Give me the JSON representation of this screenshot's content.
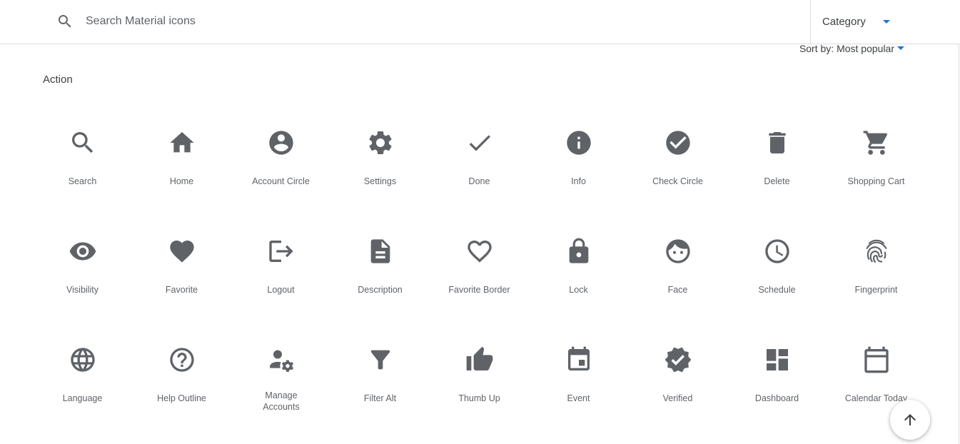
{
  "search": {
    "placeholder": "Search Material icons"
  },
  "category": {
    "label": "Category"
  },
  "sort": {
    "label": "Sort by: Most popular"
  },
  "section": {
    "title": "Action"
  },
  "colors": {
    "icon": "#5f6368",
    "accent": "#1a73e8",
    "divider": "#dadce0"
  },
  "icons": [
    {
      "name": "Search",
      "icon": "search-icon"
    },
    {
      "name": "Home",
      "icon": "home-icon"
    },
    {
      "name": "Account Circle",
      "icon": "account-circle-icon"
    },
    {
      "name": "Settings",
      "icon": "settings-icon"
    },
    {
      "name": "Done",
      "icon": "done-icon"
    },
    {
      "name": "Info",
      "icon": "info-icon"
    },
    {
      "name": "Check Circle",
      "icon": "check-circle-icon"
    },
    {
      "name": "Delete",
      "icon": "delete-icon"
    },
    {
      "name": "Shopping Cart",
      "icon": "shopping-cart-icon"
    },
    {
      "name": "Visibility",
      "icon": "visibility-icon"
    },
    {
      "name": "Favorite",
      "icon": "favorite-icon"
    },
    {
      "name": "Logout",
      "icon": "logout-icon"
    },
    {
      "name": "Description",
      "icon": "description-icon"
    },
    {
      "name": "Favorite Border",
      "icon": "favorite-border-icon"
    },
    {
      "name": "Lock",
      "icon": "lock-icon"
    },
    {
      "name": "Face",
      "icon": "face-icon"
    },
    {
      "name": "Schedule",
      "icon": "schedule-icon"
    },
    {
      "name": "Fingerprint",
      "icon": "fingerprint-icon"
    },
    {
      "name": "Language",
      "icon": "language-icon"
    },
    {
      "name": "Help Outline",
      "icon": "help-outline-icon"
    },
    {
      "name": "Manage Accounts",
      "icon": "manage-accounts-icon"
    },
    {
      "name": "Filter Alt",
      "icon": "filter-alt-icon"
    },
    {
      "name": "Thumb Up",
      "icon": "thumb-up-icon"
    },
    {
      "name": "Event",
      "icon": "event-icon"
    },
    {
      "name": "Verified",
      "icon": "verified-icon"
    },
    {
      "name": "Dashboard",
      "icon": "dashboard-icon"
    },
    {
      "name": "Calendar Today",
      "icon": "calendar-today-icon"
    }
  ],
  "fab": {
    "icon": "arrow-upward-icon"
  }
}
